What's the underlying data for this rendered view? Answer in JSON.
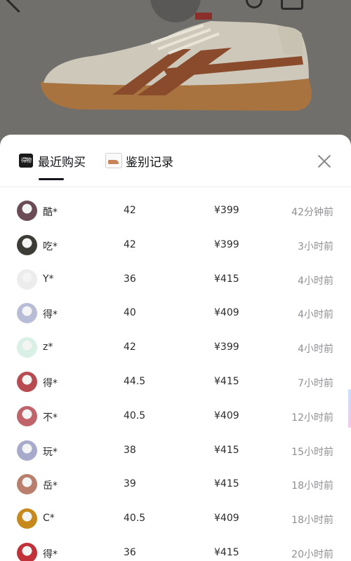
{
  "tabs": {
    "recent": {
      "label": "最近购买",
      "icon": "得物-logo-icon",
      "icon_text": "得物"
    },
    "auth": {
      "label": "鉴别记录",
      "icon": "shoe-thumbnail-icon"
    }
  },
  "purchases": [
    {
      "name": "酷*",
      "size": "42",
      "price": "¥399",
      "time": "42分钟前",
      "avatar_color": "#6b4b55"
    },
    {
      "name": "吃*",
      "size": "42",
      "price": "¥399",
      "time": "3小时前",
      "avatar_color": "#3d3c37"
    },
    {
      "name": "Y*",
      "size": "36",
      "price": "¥415",
      "time": "4小时前",
      "avatar_color": "#ececec"
    },
    {
      "name": "得*",
      "size": "40",
      "price": "¥409",
      "time": "4小时前",
      "avatar_color": "#b9bcd6"
    },
    {
      "name": "z*",
      "size": "42",
      "price": "¥399",
      "time": "4小时前",
      "avatar_color": "#d9f0e6"
    },
    {
      "name": "得*",
      "size": "44.5",
      "price": "¥415",
      "time": "7小时前",
      "avatar_color": "#b84a52"
    },
    {
      "name": "不*",
      "size": "40.5",
      "price": "¥409",
      "time": "12小时前",
      "avatar_color": "#c0636a"
    },
    {
      "name": "玩*",
      "size": "38",
      "price": "¥415",
      "time": "15小时前",
      "avatar_color": "#a8aacc"
    },
    {
      "name": "岳*",
      "size": "39",
      "price": "¥415",
      "time": "18小时前",
      "avatar_color": "#b97f6c"
    },
    {
      "name": "C*",
      "size": "40.5",
      "price": "¥409",
      "time": "18小时前",
      "avatar_color": "#c8891c"
    },
    {
      "name": "得*",
      "size": "36",
      "price": "¥415",
      "time": "20小时前",
      "avatar_color": "#c2303a"
    }
  ]
}
